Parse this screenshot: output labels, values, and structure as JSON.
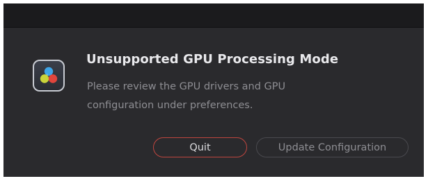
{
  "dialog": {
    "title": "Unsupported GPU Processing Mode",
    "message": "Please review the GPU drivers and GPU configuration under preferences.",
    "icon": "davinci-resolve-app-icon",
    "buttons": {
      "quit_label": "Quit",
      "update_label": "Update Configuration"
    }
  },
  "colors": {
    "background": "#2a2a2d",
    "title": "#e9e9ec",
    "message": "#8e8e93",
    "quit_border": "#c0463f"
  }
}
